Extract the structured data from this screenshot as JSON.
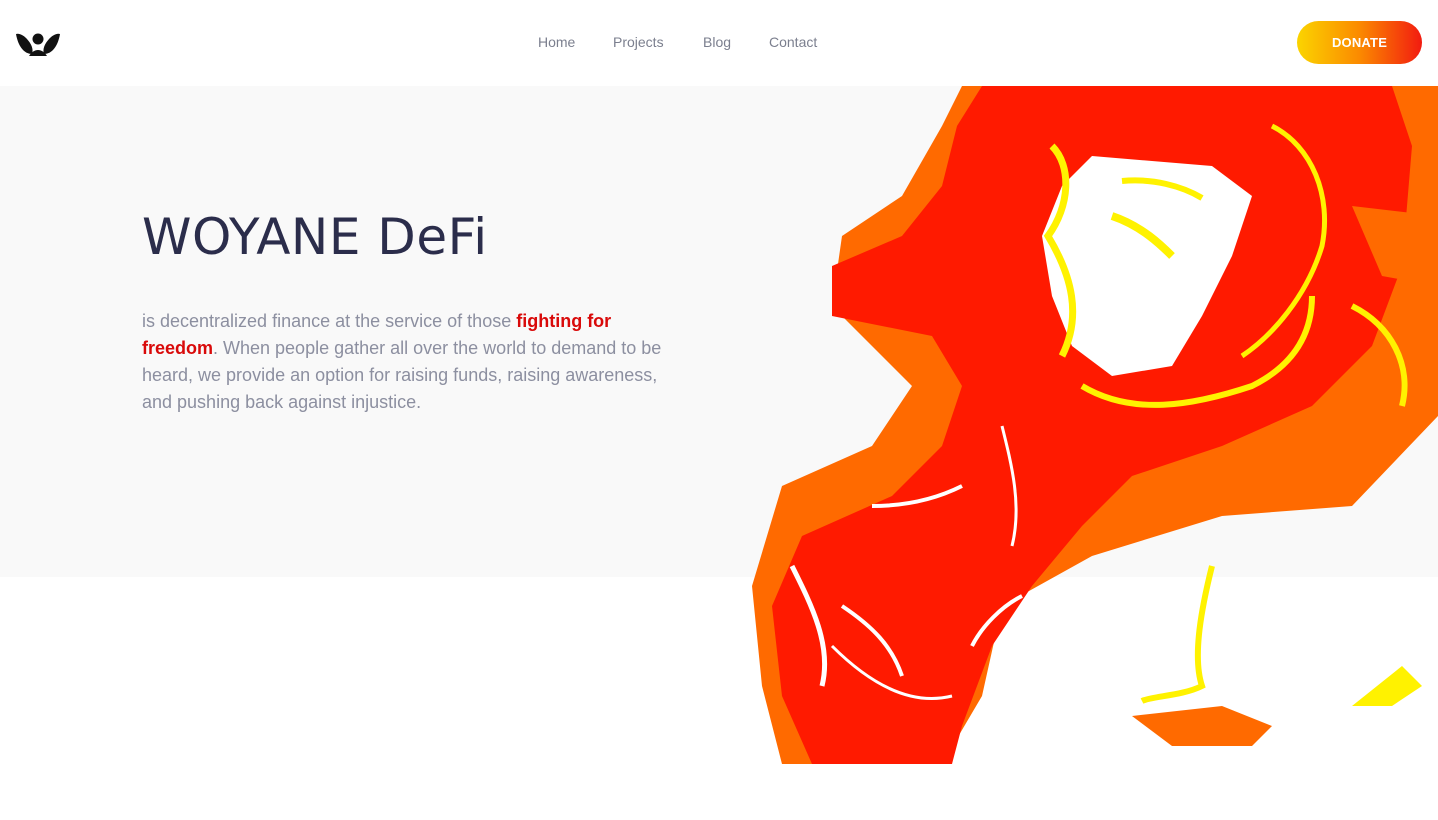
{
  "nav": {
    "items": [
      {
        "label": "Home"
      },
      {
        "label": "Projects"
      },
      {
        "label": "Blog"
      },
      {
        "label": "Contact"
      }
    ],
    "donate_label": "DONATE"
  },
  "hero": {
    "title": "WOYANE DeFi",
    "text_before": "is decentralized finance at the service of those ",
    "highlight": "fighting for freedom",
    "text_after": ". When people gather all over the world to demand to be heard, we provide an option for raising funds, raising awareness, and pushing back against injustice."
  },
  "colors": {
    "title": "#2b2d4b",
    "body_text": "#8c8fa0",
    "highlight": "#d90a0a",
    "hero_bg": "#f9f9f9",
    "donate_gradient": [
      "#fbd400",
      "#fb8a00",
      "#f21b10"
    ],
    "art_red": "#ff1a00",
    "art_orange": "#ff6a00",
    "art_yellow": "#fff200"
  },
  "icons": {
    "logo": "woyane-logo-icon"
  }
}
